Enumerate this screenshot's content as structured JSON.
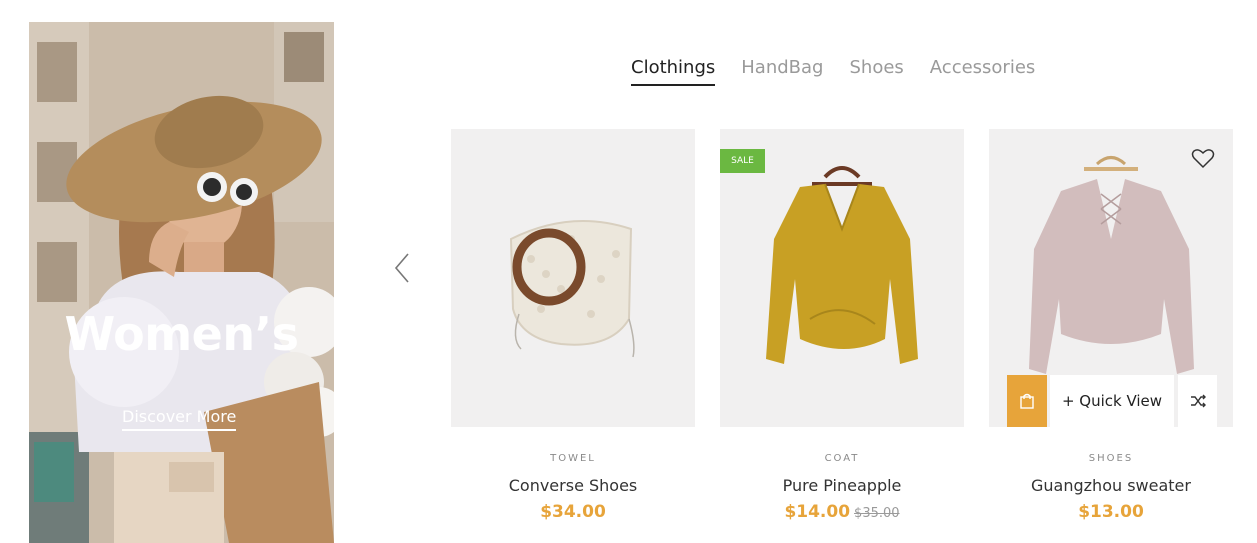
{
  "banner": {
    "title": "Women’s",
    "link_label": "Discover More"
  },
  "tabs": [
    {
      "label": "Clothings",
      "active": true
    },
    {
      "label": "HandBag",
      "active": false
    },
    {
      "label": "Shoes",
      "active": false
    },
    {
      "label": "Accessories",
      "active": false
    }
  ],
  "products": [
    {
      "category": "TOWEL",
      "name": "Converse Shoes",
      "price": "$34.00",
      "old_price": "",
      "badge": ""
    },
    {
      "category": "COAT",
      "name": "Pure Pineapple",
      "price": "$14.00",
      "old_price": "$35.00",
      "badge": "SALE"
    },
    {
      "category": "SHOES",
      "name": "Guangzhou sweater",
      "price": "$13.00",
      "old_price": "",
      "badge": ""
    }
  ],
  "hover_actions": {
    "quick_view_label": "+ Quick View"
  },
  "icons": {
    "prev": "chevron-left-icon",
    "wishlist": "heart-icon",
    "cart": "shopping-bag-icon",
    "compare": "shuffle-icon"
  },
  "colors": {
    "accent": "#e7a43a",
    "sale": "#6bb841",
    "tab_active": "#222222",
    "tab_inactive": "#9a9a9a"
  }
}
